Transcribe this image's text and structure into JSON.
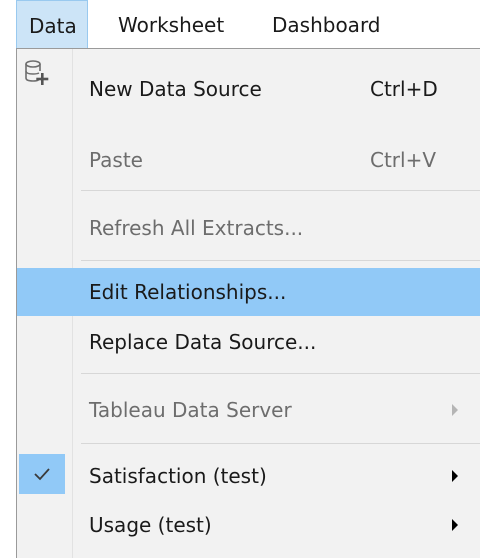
{
  "menubar": {
    "items": [
      {
        "label": "Data",
        "active": true
      },
      {
        "label": "Worksheet",
        "active": false
      },
      {
        "label": "Dashboard",
        "active": false
      }
    ]
  },
  "menu": {
    "new_data_source": {
      "label": "New Data Source",
      "shortcut": "Ctrl+D",
      "icon": "database-add-icon",
      "enabled": true
    },
    "paste": {
      "label": "Paste",
      "shortcut": "Ctrl+V",
      "enabled": false
    },
    "refresh_all_extracts": {
      "label": "Refresh All Extracts...",
      "enabled": false
    },
    "edit_relationships": {
      "label": "Edit Relationships...",
      "enabled": true,
      "highlighted": true
    },
    "replace_data_source": {
      "label": "Replace Data Source...",
      "enabled": true
    },
    "tableau_data_server": {
      "label": "Tableau Data Server",
      "enabled": false,
      "submenu": true
    },
    "satisfaction": {
      "label": "Satisfaction (test)",
      "enabled": true,
      "submenu": true,
      "checked": true
    },
    "usage": {
      "label": "Usage (test)",
      "enabled": true,
      "submenu": true
    }
  },
  "colors": {
    "highlight": "#91c9f7",
    "menu_background": "#f2f2f2",
    "active_menubar": "#cce4f7",
    "disabled_text": "#6d6d6d"
  }
}
